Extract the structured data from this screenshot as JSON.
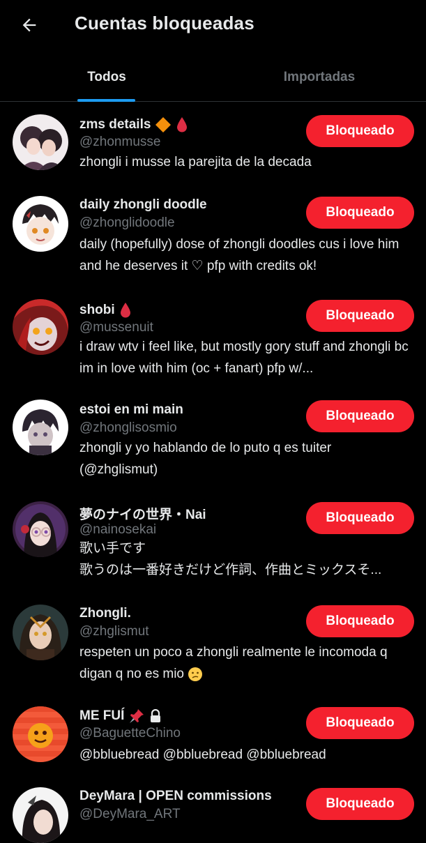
{
  "header": {
    "title": "Cuentas bloqueadas",
    "back_icon": "arrow-left-icon"
  },
  "tabs": [
    {
      "label": "Todos",
      "active": true
    },
    {
      "label": "Importadas",
      "active": false
    }
  ],
  "colors": {
    "accent": "#1d9bf0",
    "blocked_button": "#f4212e",
    "background": "#000000",
    "secondary_text": "#71767b"
  },
  "accounts": [
    {
      "name": "zms details",
      "handle": "@zhonmusse",
      "bio": "zhongli i musse la parejita de la decada",
      "button_label": "Bloqueado",
      "badges": [
        "orange-diamond-icon",
        "drop-of-blood-icon"
      ]
    },
    {
      "name": "daily zhongli doodle",
      "handle": "@zhonglidoodle",
      "bio": "daily (hopefully) dose of zhongli doodles cus i love him and he deserves it ♡ pfp with credits ok!",
      "button_label": "Bloqueado"
    },
    {
      "name": "shobi",
      "handle": "@mussenuit",
      "bio": "i draw wtv i feel like, but mostly gory stuff and zhongli bc im in love with him (oc + fanart) pfp w/...",
      "button_label": "Bloqueado",
      "badges": [
        "drop-of-blood-icon"
      ]
    },
    {
      "name": "estoi en mi main",
      "handle": "@zhonglisosmio",
      "bio": "zhongli y yo hablando de lo puto q es tuiter (@zhglismut)",
      "button_label": "Bloqueado"
    },
    {
      "name": "夢のナイの世界・Nai",
      "handle": "@nainosekai",
      "bio_line1": "歌い手です",
      "bio_line2": "歌うのは一番好きだけど作詞、作曲とミックスそ...",
      "button_label": "Bloqueado"
    },
    {
      "name": "Zhongli.",
      "handle": "@zhglismut",
      "bio": "respeten un poco a zhongli realmente le incomoda q digan q no es mio",
      "bio_emoji": "confused-face-icon",
      "button_label": "Bloqueado"
    },
    {
      "name": "ME FUÍ",
      "handle": "@BaguetteChino",
      "bio": "@bbluebread @bbluebread @bbluebread",
      "button_label": "Bloqueado",
      "badges": [
        "pushpin-icon",
        "lock-icon"
      ]
    },
    {
      "name": "DeyMara | OPEN commissions",
      "handle": "@DeyMara_ART",
      "button_label": "Bloqueado"
    }
  ]
}
